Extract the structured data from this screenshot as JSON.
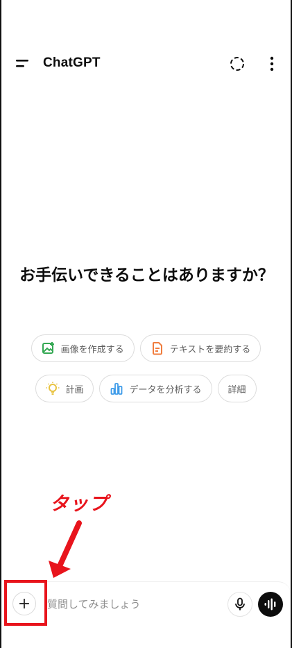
{
  "header": {
    "title": "ChatGPT",
    "menu_icon": "menu-icon",
    "temp_chat_icon": "dashed-circle-icon",
    "more_icon": "more-vertical-icon"
  },
  "main": {
    "headline": "お手伝いできることはありますか？",
    "suggestions": [
      {
        "label": "画像を作成する",
        "icon": "image-create-icon",
        "icon_color": "#34a853"
      },
      {
        "label": "テキストを要約する",
        "icon": "document-icon",
        "icon_color": "#f07c3d"
      },
      {
        "label": "計画",
        "icon": "lightbulb-icon",
        "icon_color": "#e8c341"
      },
      {
        "label": "データを分析する",
        "icon": "bar-chart-icon",
        "icon_color": "#3d9be9"
      },
      {
        "label": "詳細",
        "icon": "",
        "icon_color": ""
      }
    ]
  },
  "annotation": {
    "text": "タップ",
    "color": "#e8141c"
  },
  "composer": {
    "plus_label": "+",
    "placeholder": "質問してみましょう",
    "value": "",
    "mic_icon": "microphone-icon",
    "voice_icon": "voice-waveform-icon"
  }
}
